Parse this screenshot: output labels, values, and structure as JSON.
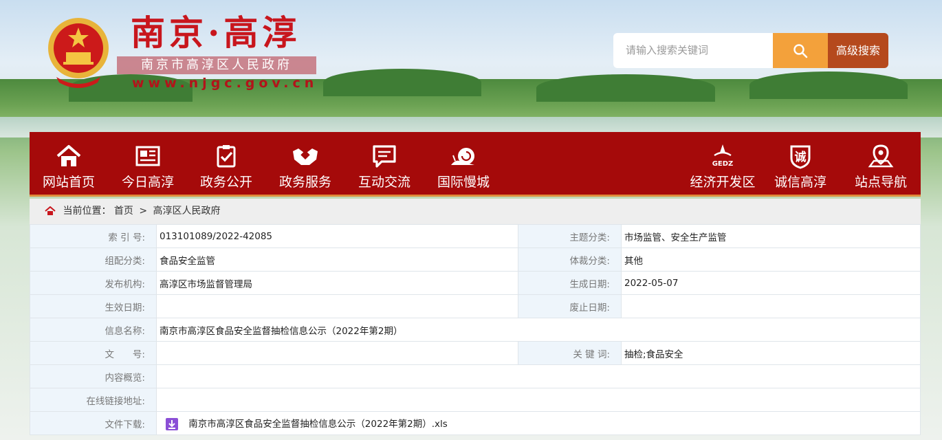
{
  "header": {
    "title": "南京·高淳",
    "subtitle": "南京市高淳区人民政府",
    "url": "www.njgc.gov.cn"
  },
  "search": {
    "placeholder": "请输入搜索关键词",
    "advanced_label": "高级搜索",
    "search_icon": "search-icon"
  },
  "nav": {
    "items": [
      {
        "label": "网站首页",
        "icon": "home-icon"
      },
      {
        "label": "今日高淳",
        "icon": "newspaper-icon"
      },
      {
        "label": "政务公开",
        "icon": "clipboard-check-icon"
      },
      {
        "label": "政务服务",
        "icon": "handshake-icon"
      },
      {
        "label": "互动交流",
        "icon": "chat-icon"
      },
      {
        "label": "国际慢城",
        "icon": "snail-icon"
      },
      {
        "label": "经济开发区",
        "icon": "gedz-icon",
        "icon_text": "GEDZ"
      },
      {
        "label": "诚信高淳",
        "icon": "integrity-shield-icon",
        "icon_text": "诚"
      },
      {
        "label": "站点导航",
        "icon": "location-pin-icon"
      }
    ],
    "bg_color": "#a50a0a"
  },
  "breadcrumb": {
    "prefix": "当前位置：",
    "home": "首页",
    "sep": ">",
    "current": "高淳区人民政府"
  },
  "info": {
    "index_label": "索 引 号:",
    "index_value": "013101089/2022-42085",
    "topic_label": "主题分类:",
    "topic_value": "市场监管、安全生产监管",
    "org_cat_label": "组配分类:",
    "org_cat_value": "食品安全监管",
    "genre_label": "体裁分类:",
    "genre_value": "其他",
    "publisher_label": "发布机构:",
    "publisher_value": "高淳区市场监督管理局",
    "created_label": "生成日期:",
    "created_value": "2022-05-07",
    "effective_label": "生效日期:",
    "effective_value": "",
    "abolish_label": "废止日期:",
    "abolish_value": "",
    "name_label": "信息名称:",
    "name_value": "南京市高淳区食品安全监督抽检信息公示（2022年第2期）",
    "docno_label": "文　　号:",
    "docno_value": "",
    "keywords_label": "关 键 词:",
    "keywords_value": "抽检;食品安全",
    "summary_label": "内容概览:",
    "summary_value": "",
    "link_label": "在线链接地址:",
    "link_value": "",
    "download_label": "文件下载:",
    "download_value": "南京市高淳区食品安全监督抽检信息公示（2022年第2期）.xls"
  }
}
